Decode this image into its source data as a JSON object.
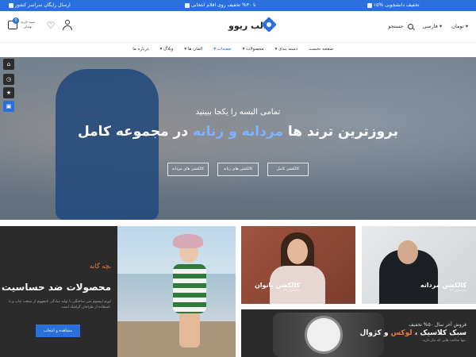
{
  "topbar": {
    "shipping": "ارسال رایگان",
    "discount_students": "۱۵% تخفیف دانشجویی",
    "discount_items": "تا ۳۰% تخفیف روی اقلام انتخابی",
    "nationwide": "سراسر کشور"
  },
  "header": {
    "cart_count": "0",
    "cart_label": "سبد خرید",
    "cart_total": "۰ تومان",
    "logo_text": "قالب ریوو",
    "currency": "تومان",
    "language": "فارسی",
    "search_label": "جستجو"
  },
  "nav": {
    "items": [
      {
        "label": "صفحه نخست",
        "active": false
      },
      {
        "label": "دسته بندی",
        "active": false
      },
      {
        "label": "محصولات",
        "active": false
      },
      {
        "label": "صفحات",
        "active": true
      },
      {
        "label": "المان ها",
        "active": false
      },
      {
        "label": "وبلاگ",
        "active": false
      },
      {
        "label": "درباره ما",
        "active": false
      }
    ]
  },
  "hero": {
    "subtitle": "تمامی البسه را یکجا ببینید",
    "title_pre": "بروزترین ترند ها",
    "title_hl": "مردانه و زنانه",
    "title_post": "در مجموعه کامل",
    "buttons": [
      "کالکشن کامل",
      "کالکشن های زنانه",
      "کالکشن های مردانه"
    ]
  },
  "promo_kids": {
    "kicker": "بچه گانه",
    "title": "محصولات ضد حساسیت",
    "desc": "لورم ایپسوم متن ساختگی با تولید سادگی نامفهوم از صنعت چاپ و با استفاده از طراحان گرافیک است.",
    "button": "مشاهده و انتخاب"
  },
  "promo_women": {
    "title": "کالکشن بانوان",
    "count": "۲۹ محصول"
  },
  "promo_men": {
    "title": "کالکشن مردانه",
    "count": "۲۹ محصول"
  },
  "promo_watch": {
    "line1": "فروش آخر سال ۵۰% تخفیف",
    "title_pre": "سبک کلاسیک ،",
    "title_hl": "لوکس",
    "title_post": "و کژوال",
    "line3": "تنها ساعت هایی که نیاز دارید."
  },
  "colors": {
    "accent": "#2a6fdb",
    "orange": "#f07a3c",
    "dark": "#2b2b2b"
  }
}
